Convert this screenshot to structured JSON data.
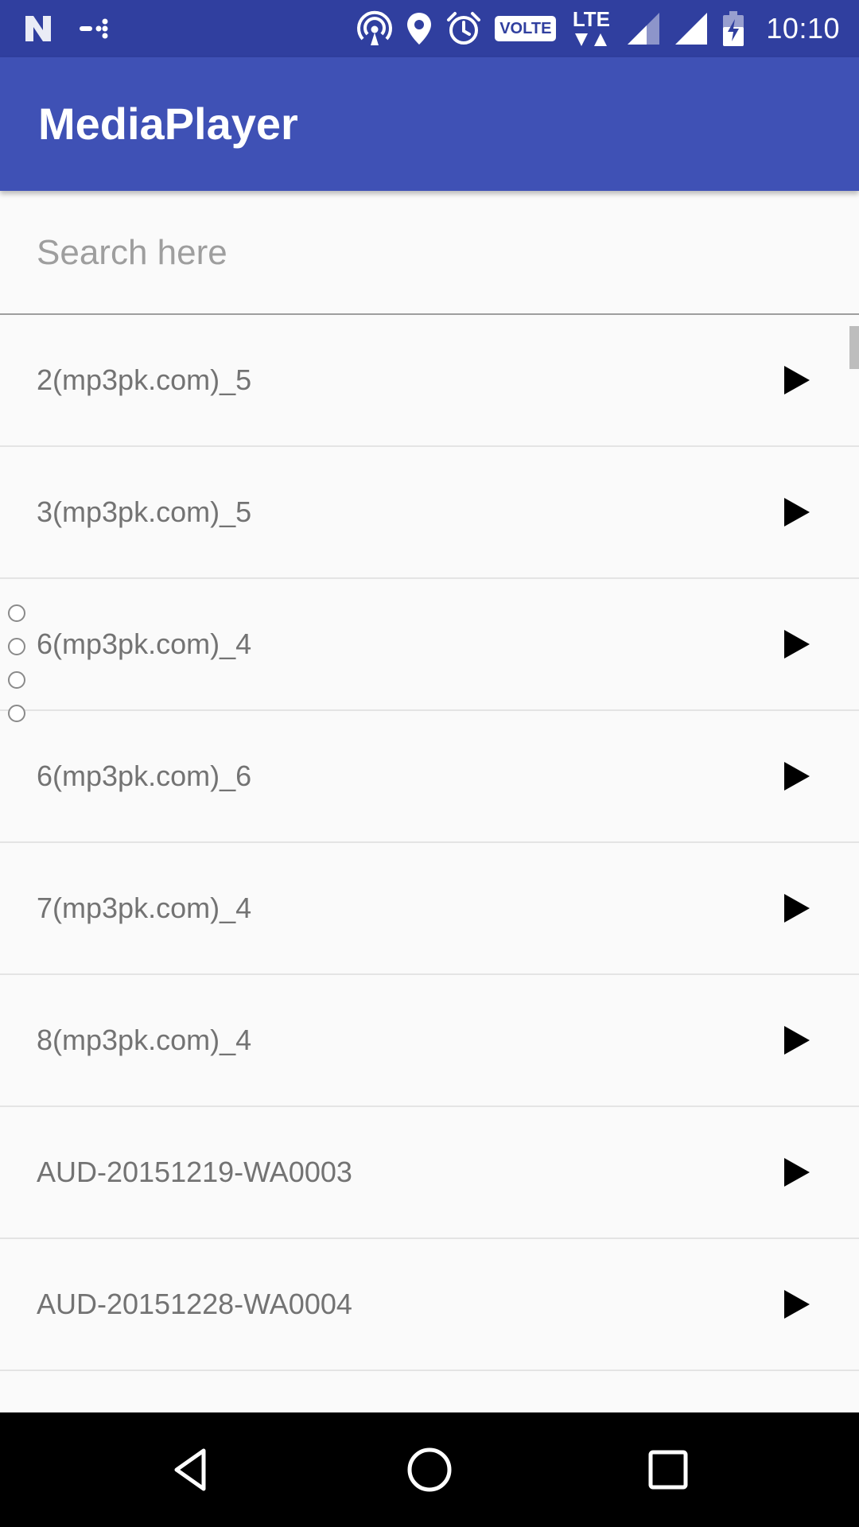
{
  "status_bar": {
    "time": "10:10",
    "volte_label": "VOLTE",
    "lte_label": "LTE",
    "icons": [
      "n-icon",
      "data-saver-icon",
      "hotspot-icon",
      "location-icon",
      "alarm-icon",
      "volte-icon",
      "lte-icon",
      "signal-icon",
      "signal-icon",
      "battery-charging-icon"
    ]
  },
  "app_bar": {
    "title": "MediaPlayer"
  },
  "search": {
    "placeholder": "Search here",
    "value": ""
  },
  "songs": [
    {
      "title": "2(mp3pk.com)_5"
    },
    {
      "title": "3(mp3pk.com)_5"
    },
    {
      "title": "6(mp3pk.com)_4"
    },
    {
      "title": "6(mp3pk.com)_6"
    },
    {
      "title": "7(mp3pk.com)_4"
    },
    {
      "title": "8(mp3pk.com)_4"
    },
    {
      "title": "AUD-20151219-WA0003"
    },
    {
      "title": "AUD-20151228-WA0004"
    },
    {
      "title": ""
    }
  ],
  "row_icon": "play-icon",
  "nav_icons": [
    "back-icon",
    "home-icon",
    "recents-icon"
  ],
  "colors": {
    "status_bar": "#303f9f",
    "app_bar": "#3f51b5",
    "list_text": "#737373",
    "background": "#fafafa"
  }
}
